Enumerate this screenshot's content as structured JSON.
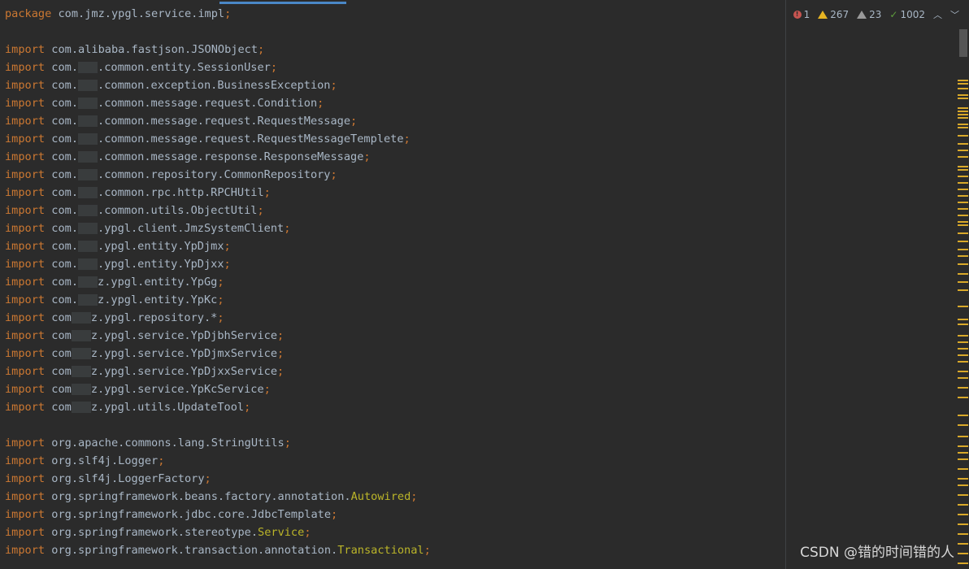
{
  "code": {
    "package_line": {
      "keyword": "package",
      "path": "com.jmz.ypgl.service.impl",
      "semi": ";"
    },
    "import_keyword": "import",
    "imports_group1": [
      {
        "pre": "com.alibaba.fastjson.JSONObject",
        "blurred": false,
        "post": ""
      },
      {
        "pre": "com.",
        "blurred": true,
        "post": ".common.entity.SessionUser"
      },
      {
        "pre": "com.",
        "blurred": true,
        "post": ".common.exception.BusinessException"
      },
      {
        "pre": "com.",
        "blurred": true,
        "post": ".common.message.request.Condition"
      },
      {
        "pre": "com.",
        "blurred": true,
        "post": ".common.message.request.RequestMessage"
      },
      {
        "pre": "com.",
        "blurred": true,
        "post": ".common.message.request.RequestMessageTemplete"
      },
      {
        "pre": "com.",
        "blurred": true,
        "post": ".common.message.response.ResponseMessage"
      },
      {
        "pre": "com.",
        "blurred": true,
        "post": ".common.repository.CommonRepository"
      },
      {
        "pre": "com.",
        "blurred": true,
        "post": ".common.rpc.http.RPCHUtil"
      },
      {
        "pre": "com.",
        "blurred": true,
        "post": ".common.utils.ObjectUtil"
      },
      {
        "pre": "com.",
        "blurred": true,
        "post": ".ypgl.client.JmzSystemClient"
      },
      {
        "pre": "com.",
        "blurred": true,
        "post": ".ypgl.entity.YpDjmx"
      },
      {
        "pre": "com.",
        "blurred": true,
        "post": ".ypgl.entity.YpDjxx"
      },
      {
        "pre": "com.",
        "blurred": true,
        "post": "z.ypgl.entity.YpGg"
      },
      {
        "pre": "com.",
        "blurred": true,
        "post": "z.ypgl.entity.YpKc"
      },
      {
        "pre": "com",
        "blurred": true,
        "post": "z.ypgl.repository.*"
      },
      {
        "pre": "com",
        "blurred": true,
        "post": "z.ypgl.service.YpDjbhService"
      },
      {
        "pre": "com",
        "blurred": true,
        "post": "z.ypgl.service.YpDjmxService"
      },
      {
        "pre": "com",
        "blurred": true,
        "post": "z.ypgl.service.YpDjxxService"
      },
      {
        "pre": "com",
        "blurred": true,
        "post": "z.ypgl.service.YpKcService"
      },
      {
        "pre": "com",
        "blurred": true,
        "post": "z.ypgl.utils.UpdateTool"
      }
    ],
    "imports_group2": [
      {
        "path": "org.apache.commons.lang.StringUtils",
        "ann": ""
      },
      {
        "path": "org.slf4j.Logger",
        "ann": ""
      },
      {
        "path": "org.slf4j.LoggerFactory",
        "ann": ""
      },
      {
        "path": "org.springframework.beans.factory.annotation.",
        "ann": "Autowired"
      },
      {
        "path": "org.springframework.jdbc.core.JdbcTemplate",
        "ann": ""
      },
      {
        "path": "org.springframework.stereotype.",
        "ann": "Service"
      },
      {
        "path": "org.springframework.transaction.annotation.",
        "ann": "Transactional"
      }
    ]
  },
  "inspection": {
    "errors": "1",
    "warnings": "267",
    "weak_warnings": "23",
    "typos": "1002",
    "colors": {
      "error": "#c75450",
      "warning": "#e6b422",
      "weak": "#9a9a9a",
      "typo": "#5f9e3c"
    }
  },
  "watermark": "CSDN @错的时间错的人",
  "colors": {
    "background": "#2b2b2b",
    "keyword": "#cc7832",
    "text": "#a9b7c6",
    "annotation": "#bbb529",
    "stripe": "#d9a92a"
  }
}
